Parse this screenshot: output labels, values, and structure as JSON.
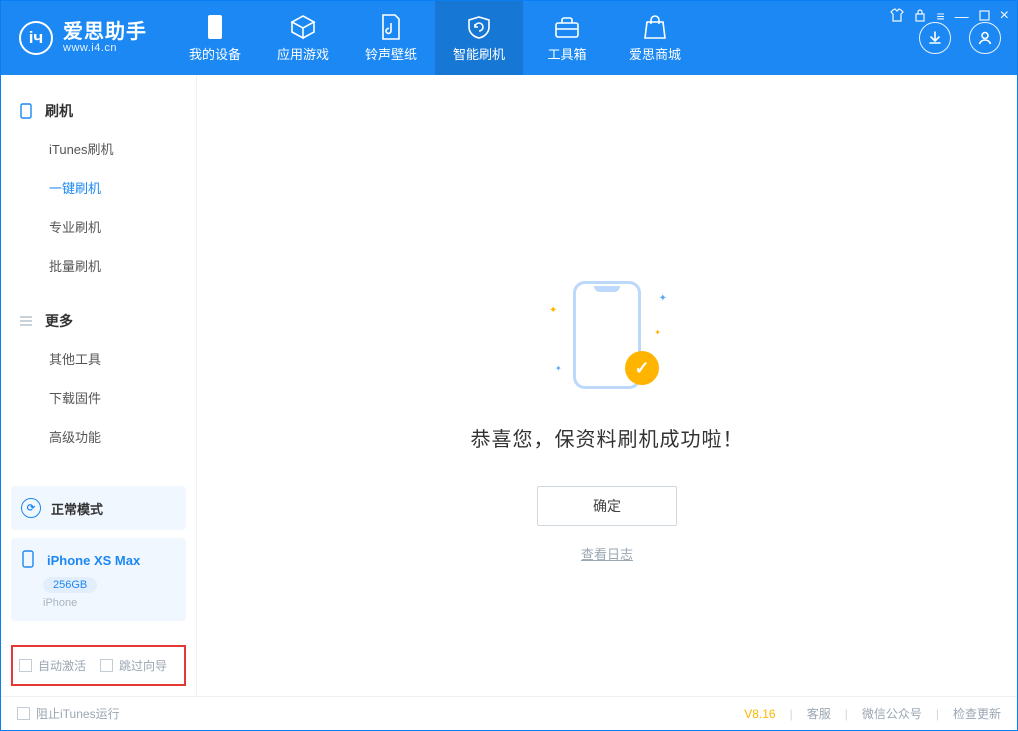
{
  "app": {
    "name": "爱思助手",
    "domain": "www.i4.cn"
  },
  "nav": {
    "items": [
      {
        "label": "我的设备"
      },
      {
        "label": "应用游戏"
      },
      {
        "label": "铃声壁纸"
      },
      {
        "label": "智能刷机"
      },
      {
        "label": "工具箱"
      },
      {
        "label": "爱思商城"
      }
    ],
    "activeIndex": 3
  },
  "sidebar": {
    "group1": {
      "title": "刷机",
      "items": [
        "iTunes刷机",
        "一键刷机",
        "专业刷机",
        "批量刷机"
      ],
      "activeIndex": 1
    },
    "group2": {
      "title": "更多",
      "items": [
        "其他工具",
        "下载固件",
        "高级功能"
      ]
    }
  },
  "device": {
    "mode": "正常模式",
    "name": "iPhone XS Max",
    "storage": "256GB",
    "type": "iPhone"
  },
  "checks": {
    "autoActivate": "自动激活",
    "skipGuide": "跳过向导"
  },
  "main": {
    "message": "恭喜您，保资料刷机成功啦！",
    "okLabel": "确定",
    "logLink": "查看日志"
  },
  "status": {
    "blockItunes": "阻止iTunes运行",
    "version": "V8.16",
    "links": [
      "客服",
      "微信公众号",
      "检查更新"
    ]
  }
}
